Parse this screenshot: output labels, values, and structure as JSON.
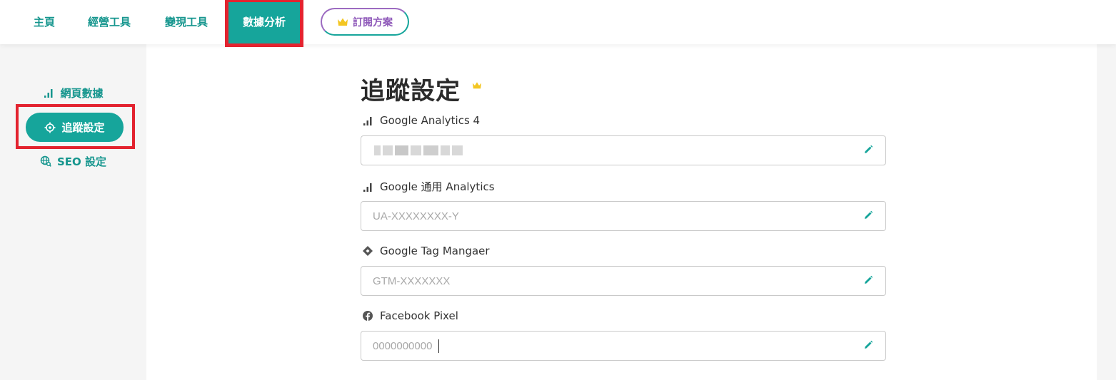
{
  "topnav": {
    "items": [
      {
        "label": "主頁"
      },
      {
        "label": "經營工具"
      },
      {
        "label": "變現工具"
      },
      {
        "label": "數據分析"
      }
    ],
    "subscribe_label": "訂閱方案"
  },
  "sidebar": {
    "items": [
      {
        "label": "網頁數據"
      },
      {
        "label": "追蹤設定"
      },
      {
        "label": "SEO 設定"
      }
    ]
  },
  "main": {
    "title": "追蹤設定",
    "fields": [
      {
        "label": "Google Analytics 4",
        "value": "",
        "placeholder": ""
      },
      {
        "label": "Google 通用 Analytics",
        "value": "",
        "placeholder": "UA-XXXXXXXX-Y"
      },
      {
        "label": "Google Tag Mangaer",
        "value": "",
        "placeholder": "GTM-XXXXXXX"
      },
      {
        "label": "Facebook Pixel",
        "value": "",
        "placeholder": "0000000000"
      }
    ]
  },
  "colors": {
    "accent": "#16a59b",
    "highlight": "#e3232f",
    "crown": "#f3c623",
    "subscribe": "#8e58b9"
  }
}
